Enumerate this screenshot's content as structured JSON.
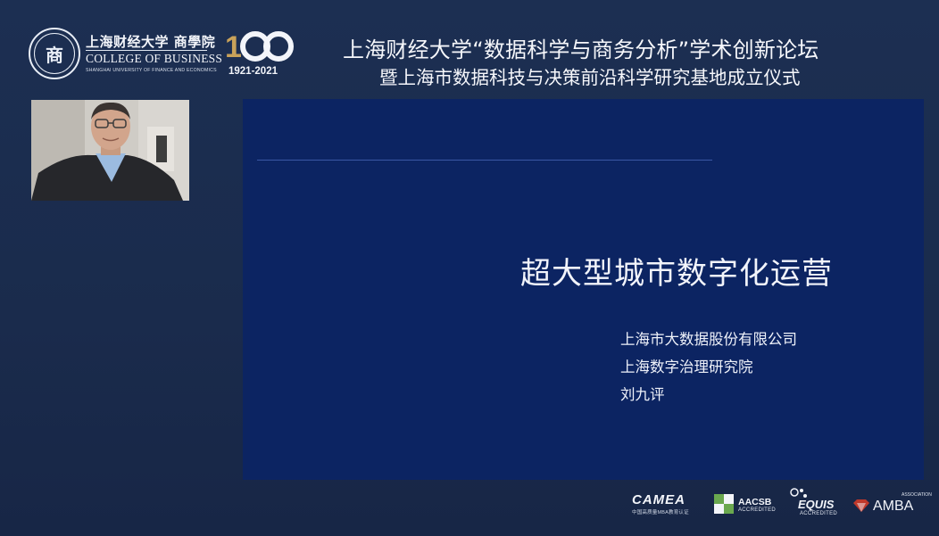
{
  "header": {
    "school_name_cn": "上海财经大学 商學院",
    "school_name_en": "COLLEGE OF BUSINESS",
    "school_name_en_sub": "SHANGHAI UNIVERSITY OF FINANCE AND ECONOMICS",
    "centennial_number": "100",
    "centennial_years": "1921-2021",
    "forum_title": "上海财经大学“数据科学与商务分析”学术创新论坛",
    "forum_subtitle": "暨上海市数据科技与决策前沿科学研究基地成立仪式"
  },
  "slide": {
    "title": "超大型城市数字化运营",
    "lines": [
      "上海市大数据股份有限公司",
      "上海数字治理研究院",
      "刘九评"
    ]
  },
  "accreditations": {
    "camea": {
      "label": "CAMEA",
      "sub": "中国高质量MBA教育认证"
    },
    "aacsb": {
      "label": "AACSB",
      "sub": "ACCREDITED"
    },
    "equis": {
      "label": "EQUIS",
      "sub": "ACCREDITED"
    },
    "amba": {
      "label": "AMBA",
      "sub": "ASSOCIATION"
    }
  },
  "colors": {
    "background": "#1b2c4e",
    "slide": "#0c2462",
    "text": "#f3f5fa"
  }
}
